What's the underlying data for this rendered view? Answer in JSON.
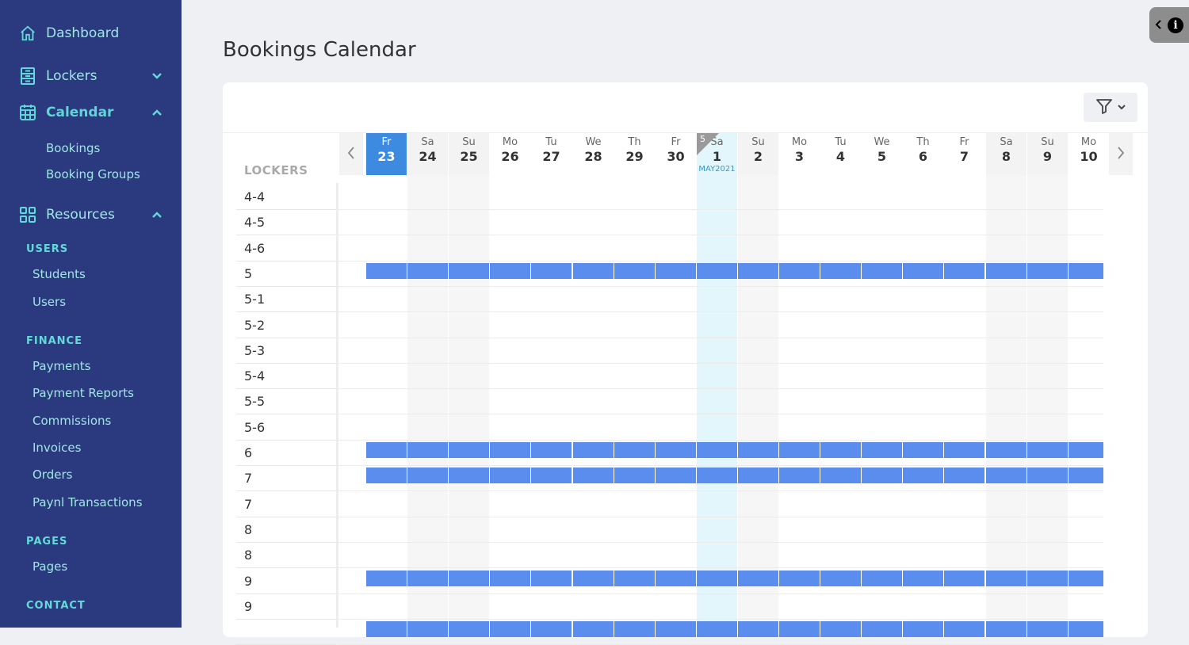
{
  "sidebar": {
    "dashboard": "Dashboard",
    "lockers": "Lockers",
    "calendar": "Calendar",
    "calendar_sub": [
      "Bookings",
      "Booking Groups"
    ],
    "resources": "Resources",
    "sections": [
      {
        "title": "USERS",
        "items": [
          "Students",
          "Users"
        ]
      },
      {
        "title": "FINANCE",
        "items": [
          "Payments",
          "Payment Reports",
          "Commissions",
          "Invoices",
          "Orders",
          "Paynl Transactions"
        ]
      },
      {
        "title": "PAGES",
        "items": [
          "Pages"
        ]
      },
      {
        "title": "CONTACT",
        "items": []
      }
    ]
  },
  "page": {
    "title": "Bookings Calendar",
    "lockers_header": "LOCKERS"
  },
  "calendar": {
    "days": [
      {
        "name": "Fr",
        "date": "23",
        "type": "today"
      },
      {
        "name": "Sa",
        "date": "24",
        "type": "weekend"
      },
      {
        "name": "Su",
        "date": "25",
        "type": "weekend"
      },
      {
        "name": "Mo",
        "date": "26",
        "type": "normal"
      },
      {
        "name": "Tu",
        "date": "27",
        "type": "normal"
      },
      {
        "name": "We",
        "date": "28",
        "type": "normal"
      },
      {
        "name": "Th",
        "date": "29",
        "type": "normal"
      },
      {
        "name": "Fr",
        "date": "30",
        "type": "normal"
      },
      {
        "name": "Sa",
        "date": "1",
        "type": "may",
        "month_label": "MAY2021",
        "corner": "5"
      },
      {
        "name": "Su",
        "date": "2",
        "type": "weekend"
      },
      {
        "name": "Mo",
        "date": "3",
        "type": "normal"
      },
      {
        "name": "Tu",
        "date": "4",
        "type": "normal"
      },
      {
        "name": "We",
        "date": "5",
        "type": "normal"
      },
      {
        "name": "Th",
        "date": "6",
        "type": "normal"
      },
      {
        "name": "Fr",
        "date": "7",
        "type": "normal"
      },
      {
        "name": "Sa",
        "date": "8",
        "type": "weekend"
      },
      {
        "name": "Su",
        "date": "9",
        "type": "weekend"
      },
      {
        "name": "Mo",
        "date": "10",
        "type": "normal"
      }
    ],
    "rows": [
      {
        "label": "4-4",
        "booked": false
      },
      {
        "label": "4-5",
        "booked": false
      },
      {
        "label": "4-6",
        "booked": false
      },
      {
        "label": "5",
        "booked": true
      },
      {
        "label": "5-1",
        "booked": false
      },
      {
        "label": "5-2",
        "booked": false
      },
      {
        "label": "5-3",
        "booked": false
      },
      {
        "label": "5-4",
        "booked": false
      },
      {
        "label": "5-5",
        "booked": false
      },
      {
        "label": "5-6",
        "booked": false
      },
      {
        "label": "6",
        "booked": true
      },
      {
        "label": "7",
        "booked": true
      },
      {
        "label": "7",
        "booked": false
      },
      {
        "label": "8",
        "booked": false
      },
      {
        "label": "8",
        "booked": false
      },
      {
        "label": "9",
        "booked": true
      },
      {
        "label": "9",
        "booked": false
      },
      {
        "label": "",
        "booked": true
      }
    ],
    "colors": {
      "today": "#3d8be0",
      "booking": "#5b8def",
      "may_highlight": "#e3f6fb"
    }
  },
  "info_tab": {
    "glyph": "i"
  }
}
